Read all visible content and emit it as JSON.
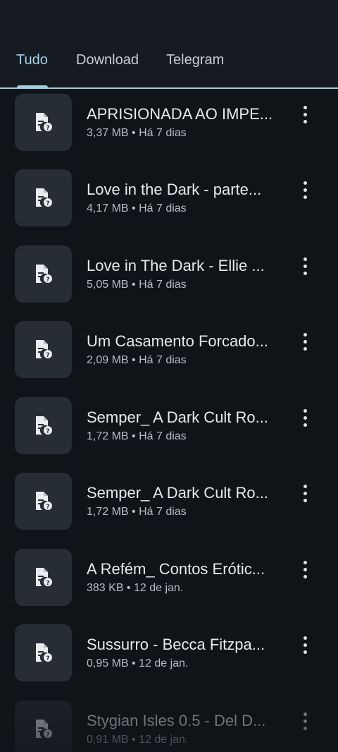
{
  "tabs": [
    {
      "label": "Tudo",
      "active": true
    },
    {
      "label": "Download",
      "active": false
    },
    {
      "label": "Telegram",
      "active": false
    }
  ],
  "colors": {
    "background": "#0f1419",
    "accent": "#9fd3ea",
    "thumbnail": "#262d34"
  },
  "files": [
    {
      "title": "APRISIONADA AO IMPE...",
      "meta": "3,37 MB • Há 7 dias",
      "icon": "unknown-file-icon"
    },
    {
      "title": "Love in the Dark - parte...",
      "meta": "4,17 MB • Há 7 dias",
      "icon": "unknown-file-icon"
    },
    {
      "title": "Love in The Dark - Ellie ...",
      "meta": "5,05 MB • Há 7 dias",
      "icon": "unknown-file-icon"
    },
    {
      "title": "Um Casamento Forcado...",
      "meta": "2,09 MB • Há 7 dias",
      "icon": "unknown-file-icon"
    },
    {
      "title": "Semper_ A Dark Cult Ro...",
      "meta": "1,72 MB • Há 7 dias",
      "icon": "unknown-file-icon"
    },
    {
      "title": "Semper_ A Dark Cult Ro...",
      "meta": "1,72 MB • Há 7 dias",
      "icon": "unknown-file-icon"
    },
    {
      "title": "A Refém_ Contos Erótic...",
      "meta": "383 KB • 12 de jan.",
      "icon": "unknown-file-icon"
    },
    {
      "title": "Sussurro - Becca Fitzpa...",
      "meta": "0,95 MB • 12 de jan.",
      "icon": "unknown-file-icon"
    },
    {
      "title": "Stygian Isles 0.5 - Del D...",
      "meta": "0,91 MB • 12 de jan.",
      "icon": "unknown-file-icon"
    }
  ]
}
